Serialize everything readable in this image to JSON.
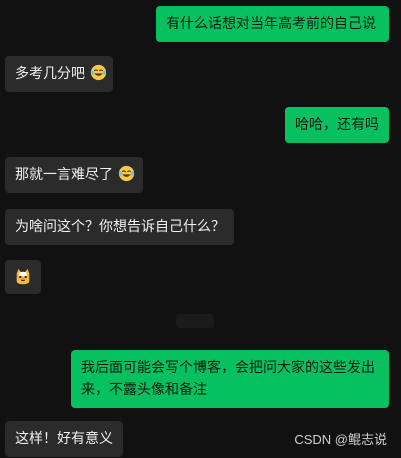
{
  "messages": [
    {
      "side": "me",
      "text": "有什么话想对当年高考前的自己说"
    },
    {
      "side": "them",
      "text": "多考几分吧",
      "emoji": "laughing-tears-emoji"
    },
    {
      "side": "me",
      "text": "哈哈，还有吗"
    },
    {
      "side": "them",
      "text": "那就一言难尽了",
      "emoji": "laughing-tears-emoji"
    },
    {
      "side": "them",
      "text": "为啥问这个？你想告诉自己什么？"
    },
    {
      "side": "them",
      "text": "",
      "emoji": "cat-face-emoji"
    },
    {
      "side": "me",
      "line1": "我后面可能会写个博客，会把问大家的这些发出",
      "line2": "来，不露头像和备注"
    },
    {
      "side": "them",
      "text": "这样！好有意义"
    }
  ],
  "watermark": "CSDN @鲲志说",
  "colors": {
    "me": "#07c160",
    "them": "#2b2b2b",
    "background": "#111111"
  }
}
